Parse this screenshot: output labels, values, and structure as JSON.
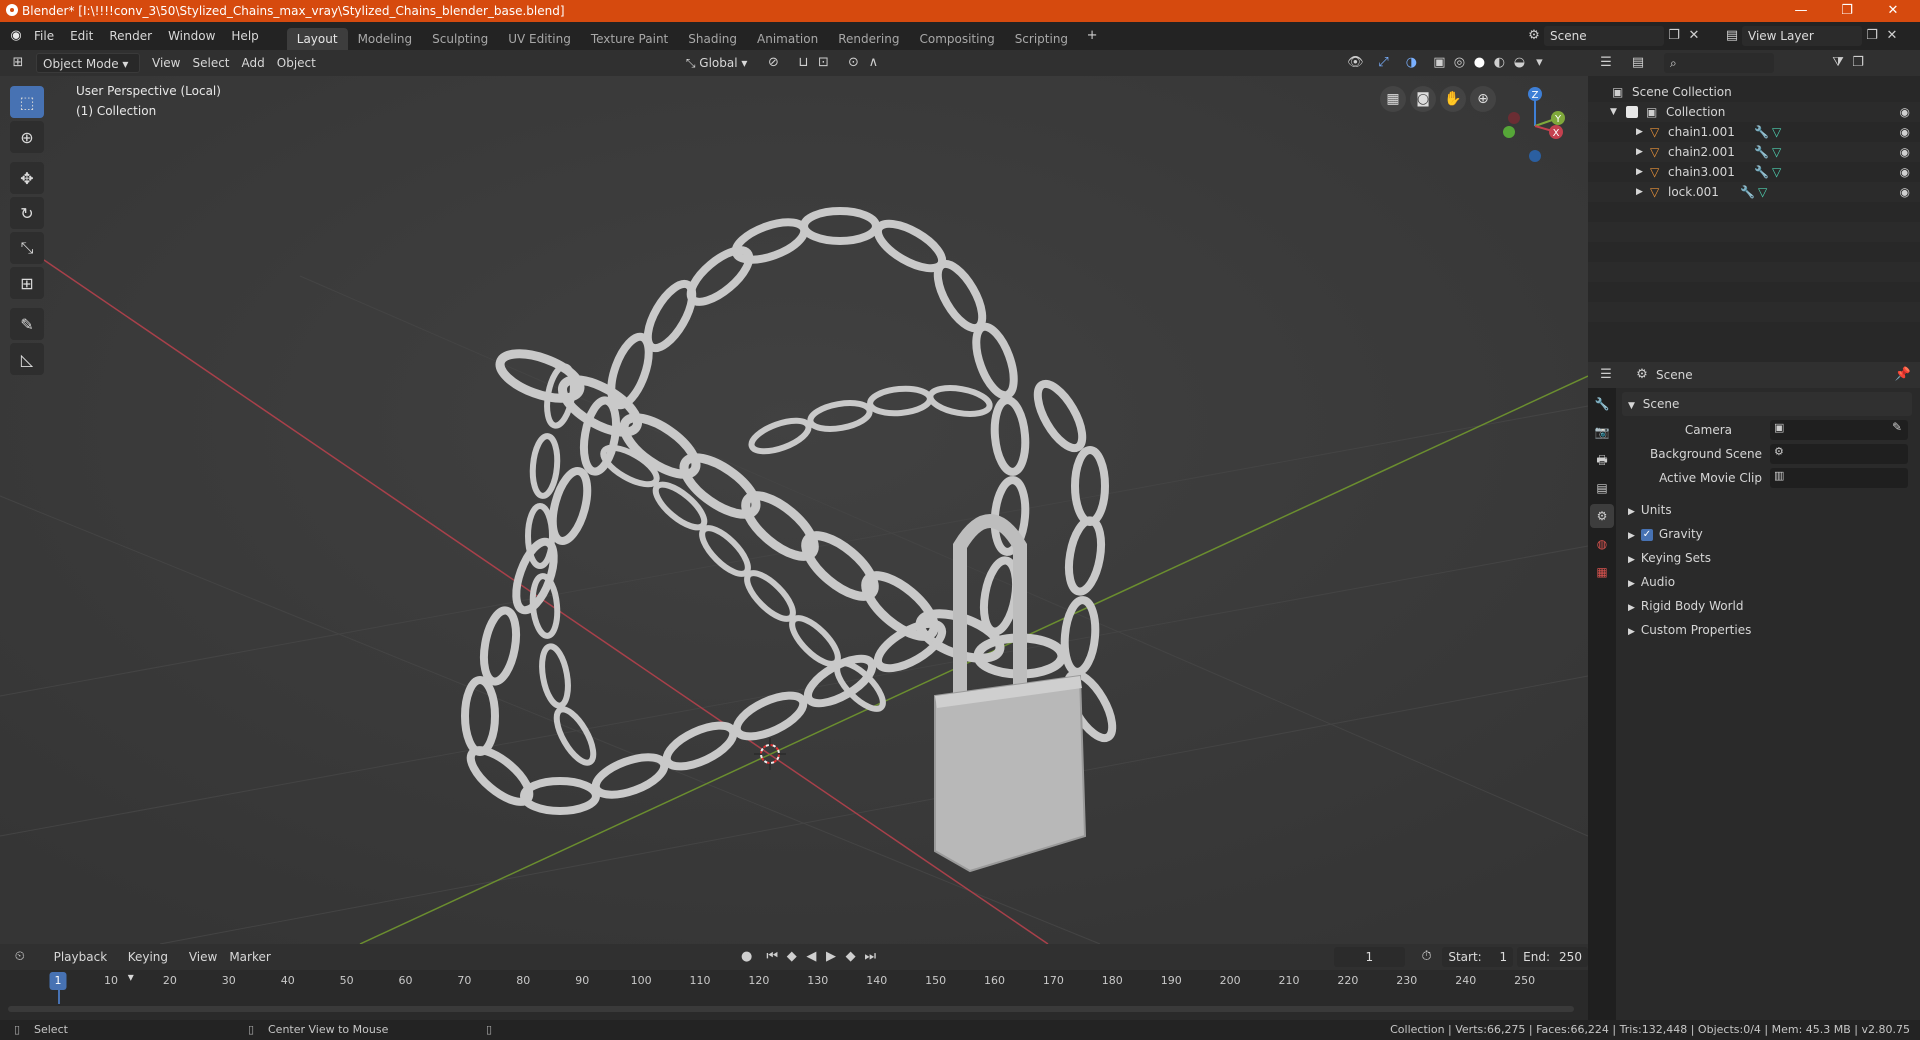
{
  "window": {
    "title": "Blender* [I:\\!!!!conv_3\\50\\Stylized_Chains_max_vray\\Stylized_Chains_blender_base.blend]",
    "minimize": "—",
    "restore": "❐",
    "close": "✕"
  },
  "menu": [
    "File",
    "Edit",
    "Render",
    "Window",
    "Help"
  ],
  "workspaces": [
    "Layout",
    "Modeling",
    "Sculpting",
    "UV Editing",
    "Texture Paint",
    "Shading",
    "Animation",
    "Rendering",
    "Compositing",
    "Scripting"
  ],
  "active_workspace": "Layout",
  "scene_field": "Scene",
  "view_layer_field": "View Layer",
  "viewport_header": {
    "mode": "Object Mode",
    "menus": [
      "View",
      "Select",
      "Add",
      "Object"
    ],
    "orientation": "Global"
  },
  "viewport": {
    "perspective": "User Perspective (Local)",
    "collection": "(1) Collection",
    "gizmo": {
      "z": "Z",
      "y": "Y",
      "x": "X"
    }
  },
  "outliner": {
    "root": "Scene Collection",
    "collection": "Collection",
    "items": [
      "chain1.001",
      "chain2.001",
      "chain3.001",
      "lock.001"
    ]
  },
  "properties": {
    "context": "Scene",
    "panel_title": "Scene",
    "camera_label": "Camera",
    "background_scene_label": "Background Scene",
    "active_movie_clip_label": "Active Movie Clip",
    "sections": [
      "Units",
      "Gravity",
      "Keying Sets",
      "Audio",
      "Rigid Body World",
      "Custom Properties"
    ],
    "gravity_checked": true
  },
  "timeline": {
    "menus": [
      "Playback",
      "Keying",
      "View",
      "Marker"
    ],
    "current_frame": "1",
    "start_label": "Start:",
    "start": "1",
    "end_label": "End:",
    "end": "250",
    "ruler": [
      "1",
      "10",
      "20",
      "30",
      "40",
      "50",
      "60",
      "70",
      "80",
      "90",
      "100",
      "110",
      "120",
      "130",
      "140",
      "150",
      "160",
      "170",
      "180",
      "190",
      "200",
      "210",
      "220",
      "230",
      "240",
      "250"
    ]
  },
  "status": {
    "select": "Select",
    "center_view": "Center View to Mouse",
    "stats": "Collection | Verts:66,275 | Faces:66,224 | Tris:132,448 | Objects:0/4 | Mem: 45.3 MB | v2.80.75"
  },
  "colors": {
    "title_bar": "#d64a0e",
    "accent": "#4772b3",
    "x_axis": "#c4414f",
    "y_axis": "#7fa83b",
    "z_axis": "#3e7fd6"
  }
}
